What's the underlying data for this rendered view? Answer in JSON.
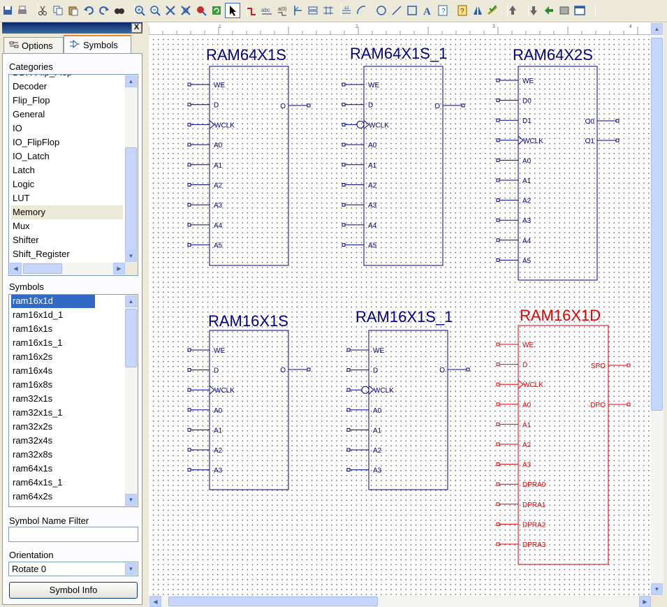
{
  "toolbar": {
    "icons": [
      "save-icon",
      "print-icon",
      "cut-icon",
      "copy-icon",
      "paste-icon",
      "undo-icon",
      "redo-icon",
      "find-icon",
      "zoom-in-icon",
      "zoom-out-icon",
      "zoom-full-icon",
      "zoom-to-box-icon",
      "zoom-selected-icon",
      "refresh-icon",
      "select-icon",
      "add-wire-icon",
      "add-net-name-icon",
      "rename-icon",
      "add-bus-tap-icon",
      "add-io-marker-icon",
      "add-symbol-icon",
      "add-net-icon",
      "arc-icon",
      "circle-icon",
      "line-icon",
      "rectangle-icon",
      "text-icon",
      "info-icon",
      "help-icon",
      "mirror-icon",
      "check-icon",
      "push-icon",
      "pop-icon",
      "up-icon",
      "view-icon",
      "window-icon"
    ]
  },
  "panel": {
    "close_label": "X",
    "tabs": [
      {
        "label": "Options",
        "icon": "options-icon"
      },
      {
        "label": "Symbols",
        "icon": "symbols-icon"
      }
    ],
    "categories_label": "Categories",
    "categories": [
      "DDR Flip_Flop",
      "Decoder",
      "Flip_Flop",
      "General",
      "IO",
      "IO_FlipFlop",
      "IO_Latch",
      "Latch",
      "Logic",
      "LUT",
      "Memory",
      "Mux",
      "Shifter",
      "Shift_Register"
    ],
    "selected_category": "Memory",
    "symbols_label": "Symbols",
    "symbols": [
      "ram16x1d",
      "ram16x1d_1",
      "ram16x1s",
      "ram16x1s_1",
      "ram16x2s",
      "ram16x4s",
      "ram16x8s",
      "ram32x1s",
      "ram32x1s_1",
      "ram32x2s",
      "ram32x4s",
      "ram32x8s",
      "ram64x1s",
      "ram64x1s_1",
      "ram64x2s"
    ],
    "selected_symbol": "ram16x1d",
    "filter_label": "Symbol Name Filter",
    "filter_value": "",
    "orientation_label": "Orientation",
    "orientation_value": "Rotate 0",
    "info_button": "Symbol Info"
  },
  "ruler": {
    "ticks": [
      "1",
      "2",
      "3",
      "4"
    ]
  },
  "canvas": {
    "symbols": [
      {
        "name": "RAM64X1S",
        "inputs": [
          "WE",
          "D",
          "WCLK",
          "A0",
          "A1",
          "A2",
          "A3",
          "A4",
          "A5"
        ],
        "outputs": [
          "O"
        ],
        "selected": false
      },
      {
        "name": "RAM64X1S_1",
        "inputs": [
          "WE",
          "D",
          "WCLK",
          "A0",
          "A1",
          "A2",
          "A3",
          "A4",
          "A5"
        ],
        "outputs": [
          "O"
        ],
        "selected": false
      },
      {
        "name": "RAM64X2S",
        "inputs": [
          "WE",
          "D0",
          "D1",
          "WCLK",
          "A0",
          "A1",
          "A2",
          "A3",
          "A4",
          "A5"
        ],
        "outputs": [
          "O0",
          "O1"
        ],
        "selected": false
      },
      {
        "name": "RAM16X1S",
        "inputs": [
          "WE",
          "D",
          "WCLK",
          "A0",
          "A1",
          "A2",
          "A3"
        ],
        "outputs": [
          "O"
        ],
        "selected": false
      },
      {
        "name": "RAM16X1S_1",
        "inputs": [
          "WE",
          "D",
          "WCLK",
          "A0",
          "A1",
          "A2",
          "A3"
        ],
        "outputs": [
          "O"
        ],
        "selected": false
      },
      {
        "name": "RAM16X1D",
        "inputs": [
          "WE",
          "D",
          "WCLK",
          "A0",
          "A1",
          "A2",
          "A3",
          "DPRA0",
          "DPRA1",
          "DPRA2",
          "DPRA3"
        ],
        "outputs": [
          "SPO",
          "DPO"
        ],
        "selected": true
      }
    ],
    "normal_color": "#000080",
    "selected_color": "#e00000"
  }
}
